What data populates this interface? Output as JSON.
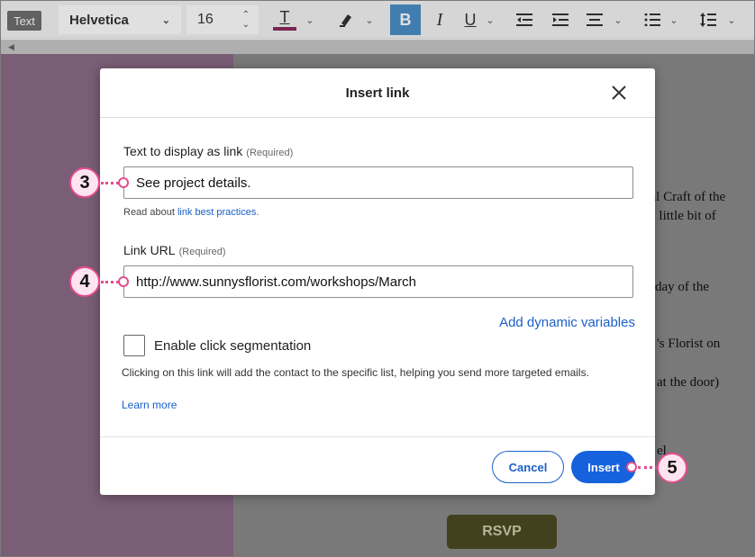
{
  "toolbar": {
    "mode_tag": "Text",
    "font_family": "Helvetica",
    "font_size": "16",
    "bold_label": "B",
    "italic_label": "I",
    "underline_label": "U",
    "text_color_label": "T",
    "text_color": "#8b2a60"
  },
  "background": {
    "lines": [
      "oral Craft of the",
      "g, a little bit of",
      "nesday of the",
      "'s Florist on",
      "at the door)",
      "el"
    ],
    "rsvp_label": "RSVP"
  },
  "dialog": {
    "title": "Insert link",
    "display_text": {
      "label": "Text to display as link",
      "required": "(Required)",
      "value": "See project details.",
      "help_prefix": "Read about ",
      "help_link": "link best practices."
    },
    "url": {
      "label": "Link URL",
      "required": "(Required)",
      "value": "http://www.sunnysflorist.com/workshops/March"
    },
    "dynamic_variables": "Add dynamic variables",
    "segmentation": {
      "label": "Enable click segmentation",
      "checked": false,
      "description": "Clicking on this link will add the contact to the specific list, helping you send more targeted emails.",
      "learn_more": "Learn more"
    },
    "cancel_label": "Cancel",
    "insert_label": "Insert"
  },
  "callouts": [
    "3",
    "4",
    "5"
  ],
  "colors": {
    "accent": "#1b5fc9",
    "callout": "#e34d8e",
    "bold_active": "#4a90c8"
  }
}
